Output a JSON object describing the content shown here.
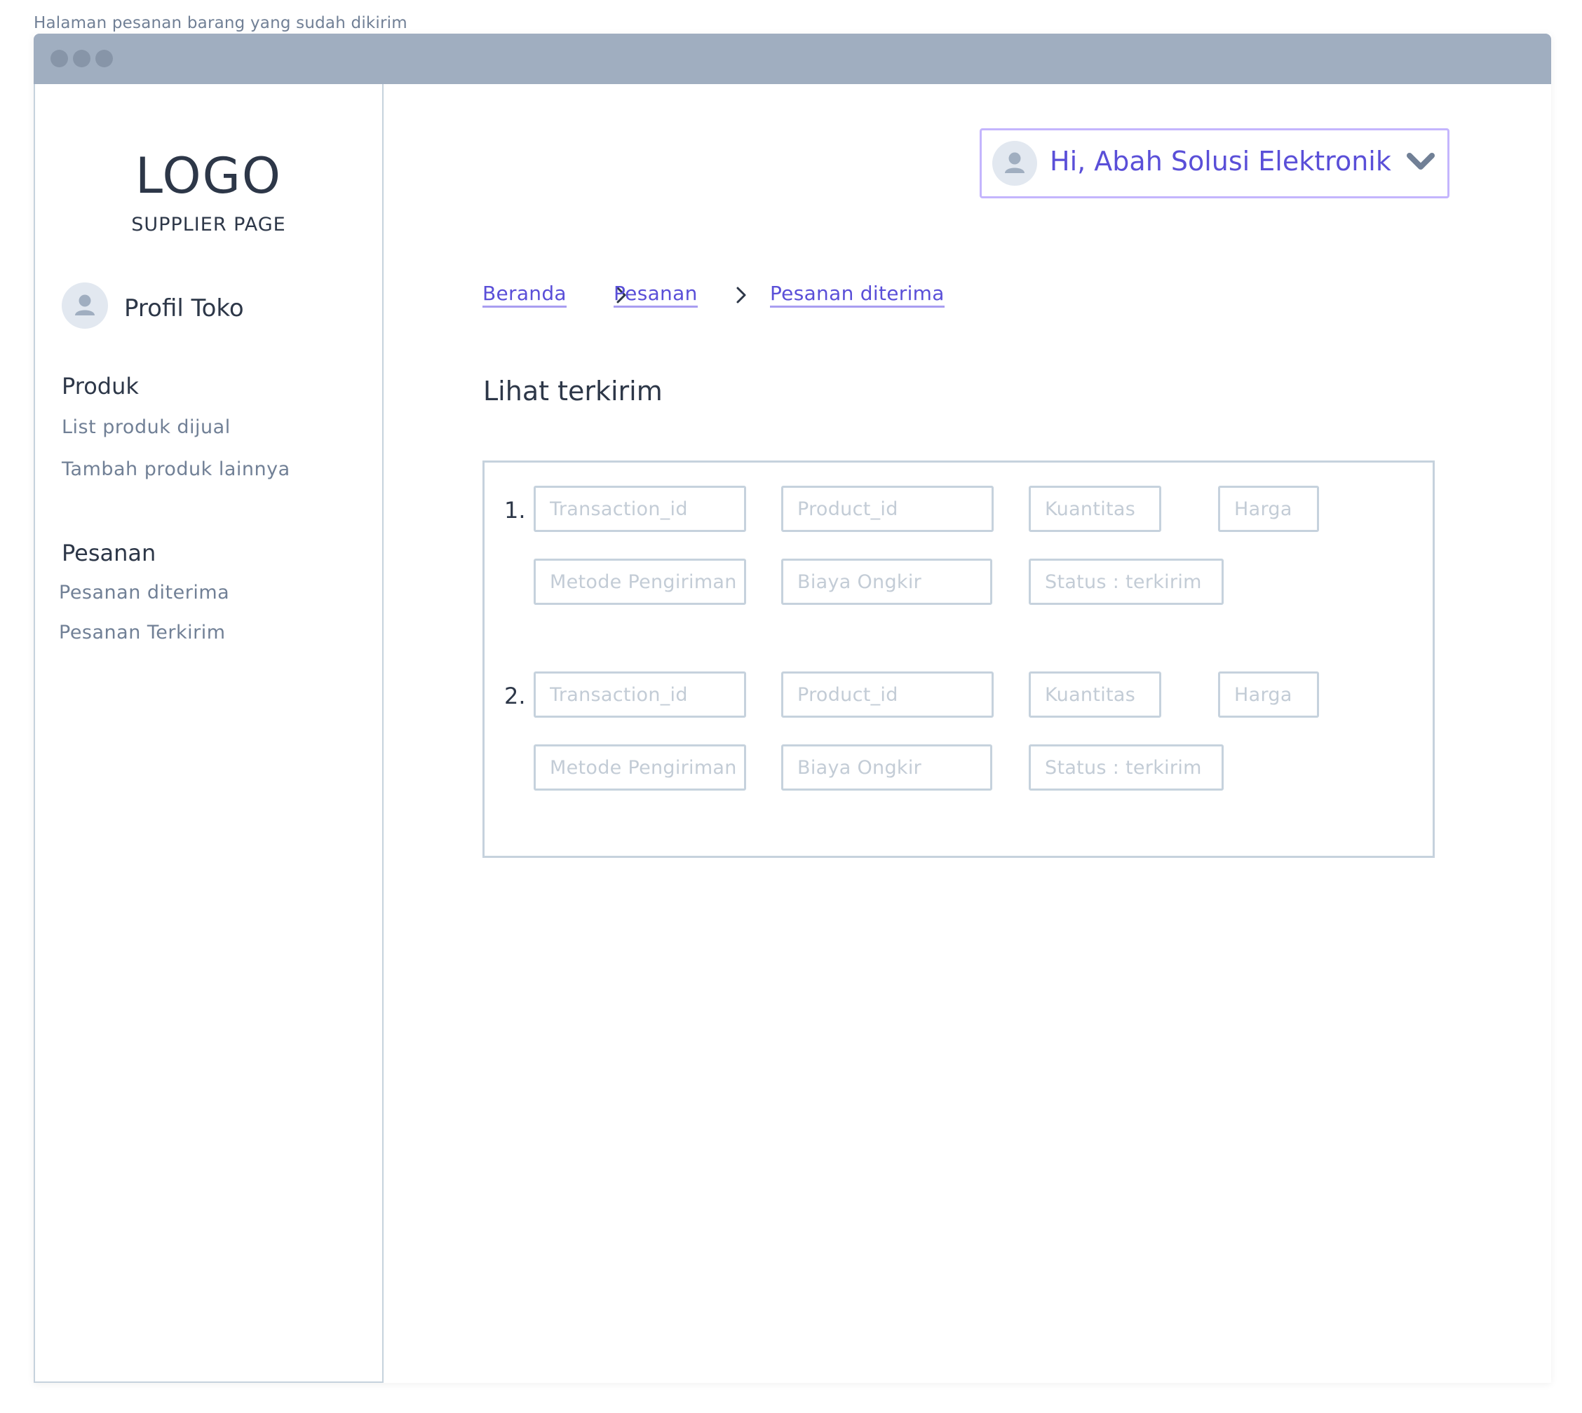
{
  "page_caption": "Halaman pesanan barang yang sudah dikirim",
  "sidebar": {
    "logo": "LOGO",
    "subtitle": "SUPPLIER PAGE",
    "profile_label": "Profil Toko",
    "sections": [
      {
        "title": "Produk",
        "items": [
          "List produk dijual",
          "Tambah produk lainnya"
        ]
      },
      {
        "title": "Pesanan",
        "items": [
          "Pesanan diterima",
          "Pesanan Terkirim"
        ]
      }
    ]
  },
  "header": {
    "user_greeting": "Hi, Abah Solusi Elektronik"
  },
  "breadcrumb": [
    "Beranda",
    "Pesanan",
    "Pesanan diterima"
  ],
  "main": {
    "heading": "Lihat terkirim",
    "orders": [
      {
        "number": "1.",
        "placeholders": {
          "transaction_id": "Transaction_id",
          "product_id": "Product_id",
          "quantity": "Kuantitas",
          "price": "Harga",
          "shipping_method": "Metode Pengiriman",
          "shipping_cost": "Biaya Ongkir",
          "status": "Status : terkirim"
        }
      },
      {
        "number": "2.",
        "placeholders": {
          "transaction_id": "Transaction_id",
          "product_id": "Product_id",
          "quantity": "Kuantitas",
          "price": "Harga",
          "shipping_method": "Metode Pengiriman",
          "shipping_cost": "Biaya Ongkir",
          "status": "Status : terkirim"
        }
      }
    ]
  },
  "colors": {
    "accent": "#5a4fd8",
    "border": "#c6d2dd",
    "titlebar": "#a0aec0"
  }
}
